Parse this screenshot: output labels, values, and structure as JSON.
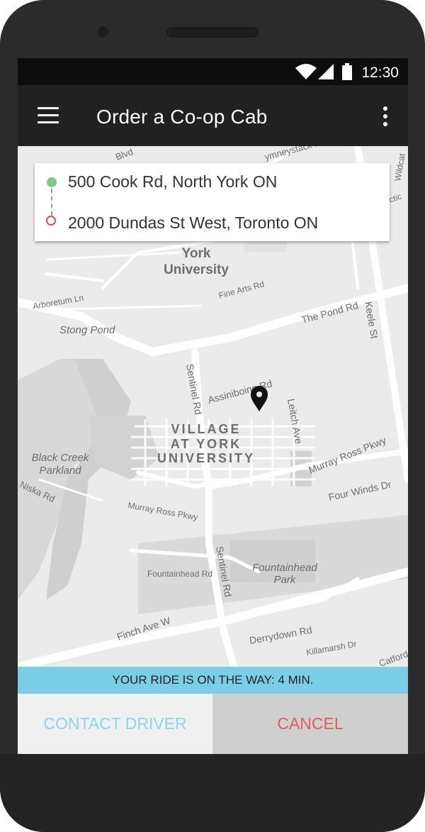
{
  "status_bar": {
    "time": "12:30"
  },
  "app_bar": {
    "title": "Order a Co-op Cab"
  },
  "route": {
    "from": "500 Cook Rd, North York ON",
    "to": "2000 Dundas St West, Toronto ON"
  },
  "map": {
    "labels": {
      "york_university_line1": "York",
      "york_university_line2": "University",
      "arboretum_ln": "Arboretum Ln",
      "stong_pond": "Stong Pond",
      "fine_arts_rd": "Fine Arts Rd",
      "the_pond_rd": "The Pond Rd",
      "keele_st": "Keele St",
      "sentinel_rd_north": "Sentinel Rd",
      "assiniboine_rd": "Assiniboine Rd",
      "leitch_ave": "Leitch Ave",
      "village_line1": "VILLAGE",
      "village_line2": "AT YORK",
      "village_line3": "UNIVERSITY",
      "murray_ross_pkwy_east": "Murray Ross Pkwy",
      "murray_ross_pkwy_west": "Murray Ross Pkwy",
      "black_creek_line1": "Black Creek",
      "black_creek_line2": "Parkland",
      "four_winds_dr": "Four Winds Dr",
      "niska_rd": "Niska Rd",
      "sentinel_rd_south": "Sentinel Rd",
      "fountainhead_rd": "Fountainhead Rd",
      "fountainhead_park_line1": "Fountainhead",
      "fountainhead_park_line2": "Park",
      "finch_ave_w": "Finch Ave W",
      "derrydown_rd": "Derrydown Rd",
      "killamarsh_dr": "Killamarsh Dr",
      "catford": "Catford",
      "blvd": "Blvd",
      "ymneystack_rd": "ymneystack Rd",
      "wildcat": "Wildcat",
      "arctic": "ctic"
    }
  },
  "banner": {
    "text": "YOUR RIDE IS ON THE WAY: 4 MIN."
  },
  "actions": {
    "contact_label": "CONTACT DRIVER",
    "cancel_label": "CANCEL"
  },
  "colors": {
    "banner": "#7acfe6",
    "contact_text": "#8fd5ea",
    "cancel_text": "#e25c5c",
    "app_bar": "#212121"
  }
}
